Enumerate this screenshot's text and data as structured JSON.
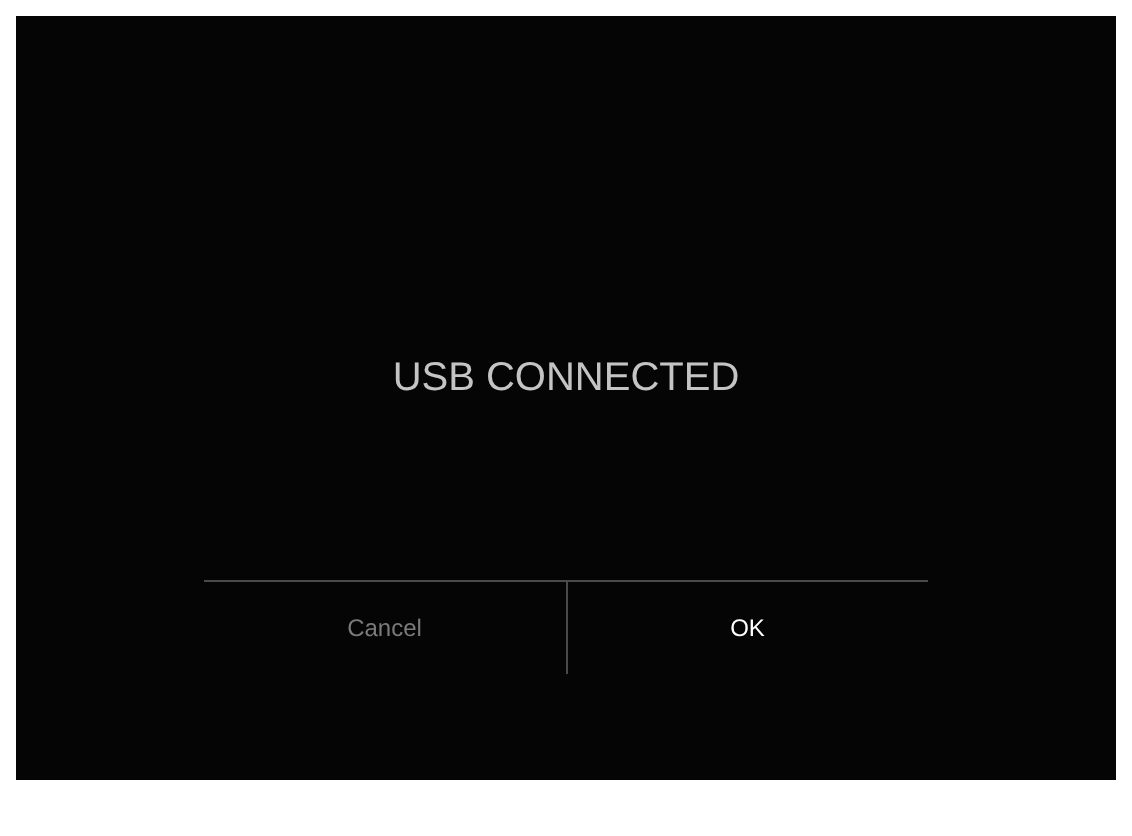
{
  "dialog": {
    "message": "USB CONNECTED",
    "buttons": [
      {
        "label": "Cancel",
        "selected": false
      },
      {
        "label": "OK",
        "selected": true
      }
    ]
  }
}
